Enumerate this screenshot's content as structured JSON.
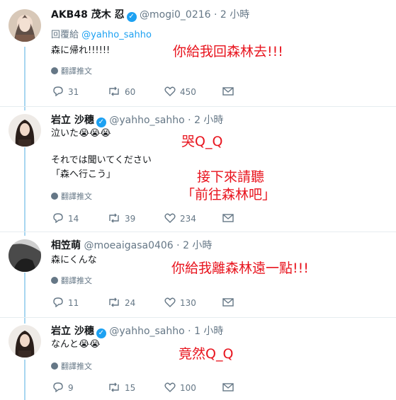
{
  "tweets": [
    {
      "name": "AKB48 茂木 忍",
      "handle": "@mogi0_0216",
      "time": "2 小時",
      "reply_label": "回覆給",
      "reply_to": "@yahho_sahho",
      "text": "森に帰れ!!!!!!",
      "translate": "翻譯推文",
      "replies": "31",
      "retweets": "60",
      "likes": "450",
      "annotation": "你給我回森林去!!!"
    },
    {
      "name": "岩立 沙穗",
      "handle": "@yahho_sahho",
      "time": "2 小時",
      "text": "泣いた😭😭😭",
      "text2_line1": "それでは聞いてください",
      "text2_line2": "「森へ行こう」",
      "translate": "翻譯推文",
      "replies": "14",
      "retweets": "39",
      "likes": "234",
      "annotation": "哭Q_Q",
      "annotation2_line1": "接下來請聽",
      "annotation2_line2": "「前往森林吧」"
    },
    {
      "name": "相笠萌",
      "handle": "@moeaigasa0406",
      "time": "2 小時",
      "text": "森にくんな",
      "translate": "翻譯推文",
      "replies": "11",
      "retweets": "24",
      "likes": "130",
      "annotation": "你給我離森林遠一點!!!"
    },
    {
      "name": "岩立 沙穗",
      "handle": "@yahho_sahho",
      "time": "1 小時",
      "text": "なんと😭😭",
      "translate": "翻譯推文",
      "replies": "9",
      "retweets": "15",
      "likes": "100",
      "annotation": "竟然Q_Q"
    }
  ],
  "separator": "·",
  "colors": {
    "annotation": "#e8141e",
    "link": "#1da1f2",
    "muted": "#657786",
    "thread": "#a8d6f0"
  }
}
